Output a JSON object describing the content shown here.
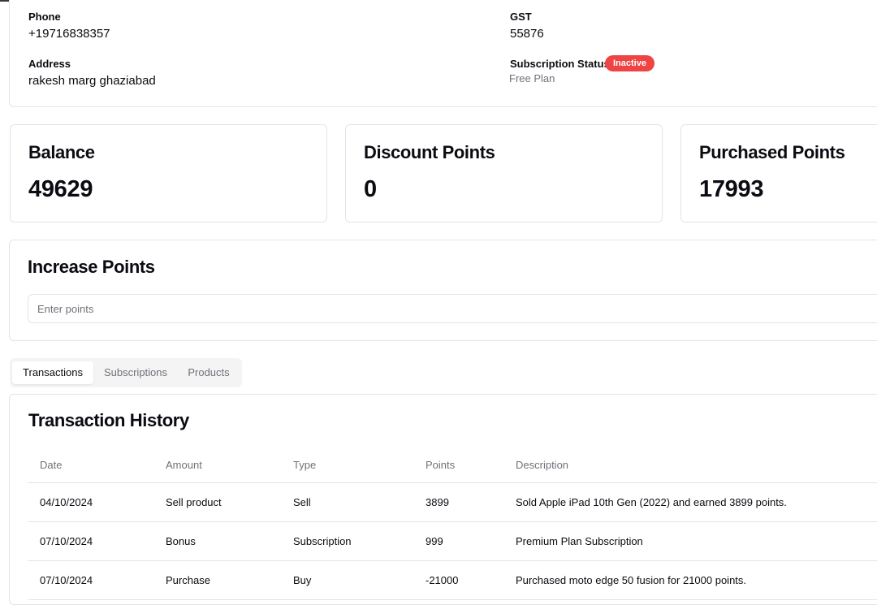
{
  "profile": {
    "phone_label": "Phone",
    "phone_value": "+19716838357",
    "gst_label": "GST",
    "gst_value": "55876",
    "address_label": "Address",
    "address_value": "rakesh marg ghaziabad",
    "subscription_label": "Subscription Status",
    "subscription_badge": "Inactive",
    "plan": "Free Plan"
  },
  "stats": [
    {
      "title": "Balance",
      "value": "49629"
    },
    {
      "title": "Discount Points",
      "value": "0"
    },
    {
      "title": "Purchased Points",
      "value": "17993"
    }
  ],
  "increase": {
    "title": "Increase Points",
    "placeholder": "Enter points"
  },
  "tabs": [
    {
      "label": "Transactions",
      "active": true
    },
    {
      "label": "Subscriptions",
      "active": false
    },
    {
      "label": "Products",
      "active": false
    }
  ],
  "transactions": {
    "title": "Transaction History",
    "columns": [
      "Date",
      "Amount",
      "Type",
      "Points",
      "Description"
    ],
    "rows": [
      [
        "04/10/2024",
        "Sell product",
        "Sell",
        "3899",
        "Sold Apple iPad 10th Gen (2022) and earned 3899 points."
      ],
      [
        "07/10/2024",
        "Bonus",
        "Subscription",
        "999",
        "Premium Plan Subscription"
      ],
      [
        "07/10/2024",
        "Purchase",
        "Buy",
        "-21000",
        "Purchased moto edge 50 fusion for 21000 points."
      ]
    ]
  },
  "colors": {
    "badge_inactive": "#ef4444",
    "border": "#e4e4e7",
    "muted_text": "#71717a",
    "tab_bg": "#f4f4f5"
  }
}
